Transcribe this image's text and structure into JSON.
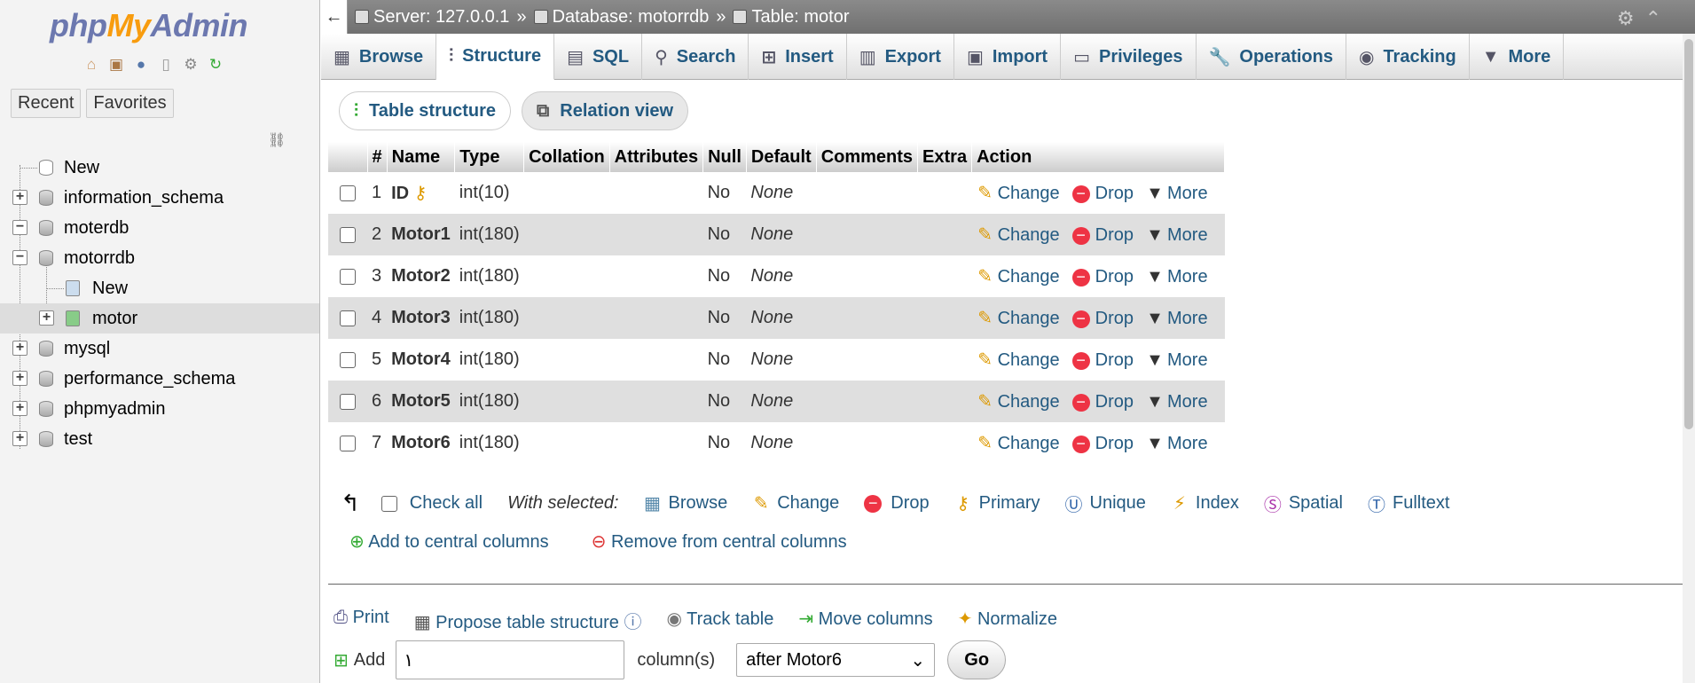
{
  "sidebar": {
    "logo": {
      "php": "php",
      "my": "My",
      "admin": "Admin"
    },
    "quicklinks": [
      "home-icon",
      "exit-icon",
      "help-icon",
      "docs-icon",
      "settings-icon",
      "reload-icon"
    ],
    "tabs": {
      "recent": "Recent",
      "favorites": "Favorites"
    },
    "tree": [
      {
        "label": "New",
        "type": "new"
      },
      {
        "label": "information_schema",
        "type": "db"
      },
      {
        "label": "moterdb",
        "type": "db"
      },
      {
        "label": "motorrdb",
        "type": "db"
      },
      {
        "label": "New",
        "type": "new-table"
      },
      {
        "label": "motor",
        "type": "table"
      },
      {
        "label": "mysql",
        "type": "db"
      },
      {
        "label": "performance_schema",
        "type": "db"
      },
      {
        "label": "phpmyadmin",
        "type": "db"
      },
      {
        "label": "test",
        "type": "db"
      }
    ]
  },
  "breadcrumb": {
    "back": "←",
    "server": "Server: 127.0.0.1",
    "database": "Database: motorrdb",
    "table": "Table: motor",
    "sep": "»"
  },
  "tabs": [
    "Browse",
    "Structure",
    "SQL",
    "Search",
    "Insert",
    "Export",
    "Import",
    "Privileges",
    "Operations",
    "Tracking",
    "More"
  ],
  "active_tab": "Structure",
  "subtabs": {
    "table_structure": "Table structure",
    "relation_view": "Relation view"
  },
  "columns_header": [
    "#",
    "Name",
    "Type",
    "Collation",
    "Attributes",
    "Null",
    "Default",
    "Comments",
    "Extra",
    "Action"
  ],
  "columns": [
    {
      "num": "1",
      "name": "ID",
      "type": "int(10)",
      "null": "No",
      "default": "None",
      "primary": true
    },
    {
      "num": "2",
      "name": "Motor1",
      "type": "int(180)",
      "null": "No",
      "default": "None"
    },
    {
      "num": "3",
      "name": "Motor2",
      "type": "int(180)",
      "null": "No",
      "default": "None"
    },
    {
      "num": "4",
      "name": "Motor3",
      "type": "int(180)",
      "null": "No",
      "default": "None"
    },
    {
      "num": "5",
      "name": "Motor4",
      "type": "int(180)",
      "null": "No",
      "default": "None"
    },
    {
      "num": "6",
      "name": "Motor5",
      "type": "int(180)",
      "null": "No",
      "default": "None"
    },
    {
      "num": "7",
      "name": "Motor6",
      "type": "int(180)",
      "null": "No",
      "default": "None"
    }
  ],
  "row_actions": {
    "change": "Change",
    "drop": "Drop",
    "more": "More"
  },
  "with_selected": {
    "check_all": "Check all",
    "label": "With selected:",
    "actions": [
      "Browse",
      "Change",
      "Drop",
      "Primary",
      "Unique",
      "Index",
      "Spatial",
      "Fulltext"
    ]
  },
  "central": {
    "add": "Add to central columns",
    "remove": "Remove from central columns"
  },
  "bottom_links": {
    "print": "Print",
    "propose": "Propose table structure",
    "track": "Track table",
    "move": "Move columns",
    "normalize": "Normalize"
  },
  "add_column": {
    "label": "Add",
    "value": "١",
    "suffix": "column(s)",
    "after": "after Motor6",
    "go": "Go"
  }
}
